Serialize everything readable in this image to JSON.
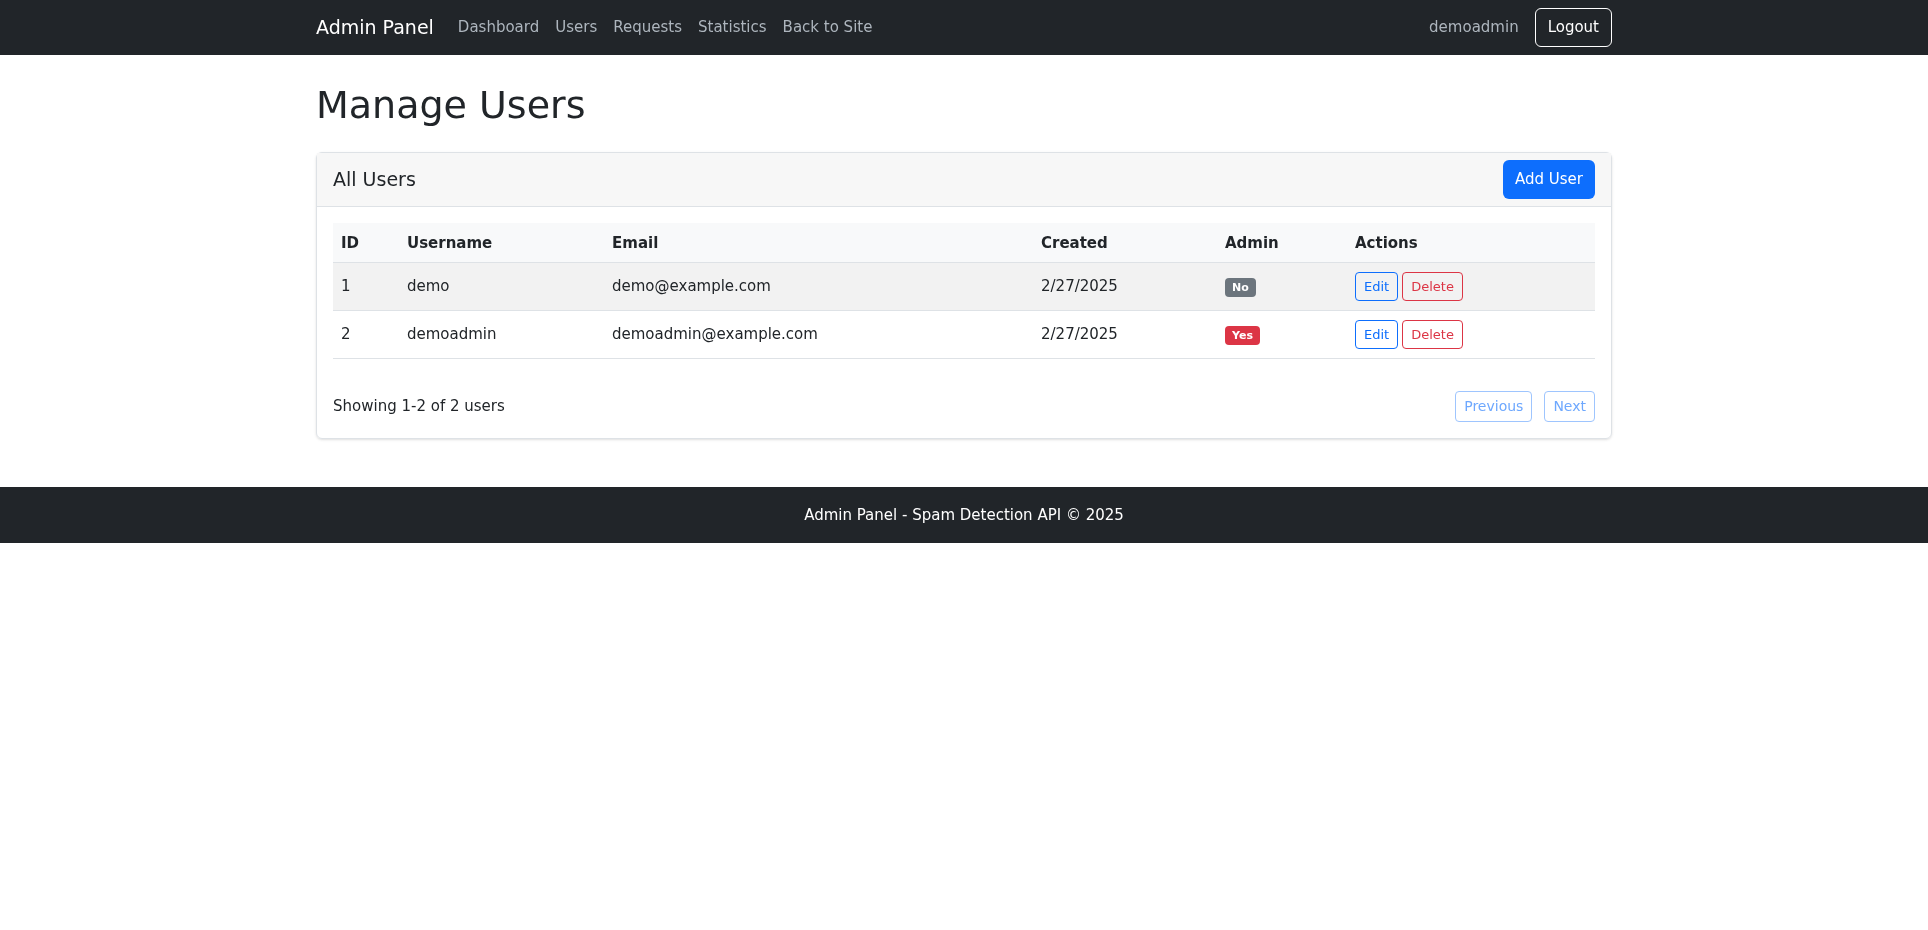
{
  "navbar": {
    "brand": "Admin Panel",
    "links": [
      "Dashboard",
      "Users",
      "Requests",
      "Statistics",
      "Back to Site"
    ],
    "user": "demoadmin",
    "logout": "Logout"
  },
  "page_title": "Manage Users",
  "card": {
    "title": "All Users",
    "add_button": "Add User"
  },
  "table": {
    "columns": [
      "ID",
      "Username",
      "Email",
      "Created",
      "Admin",
      "Actions"
    ],
    "rows": [
      {
        "id": "1",
        "username": "demo",
        "email": "demo@example.com",
        "created": "2/27/2025",
        "admin": false,
        "admin_label": "No",
        "actions": [
          "Edit",
          "Delete"
        ]
      },
      {
        "id": "2",
        "username": "demoadmin",
        "email": "demoadmin@example.com",
        "created": "2/27/2025",
        "admin": true,
        "admin_label": "Yes",
        "actions": [
          "Edit",
          "Delete"
        ]
      }
    ]
  },
  "pagination": {
    "summary": "Showing 1-2 of 2 users",
    "previous": {
      "label": "Previous",
      "disabled": true
    },
    "next": {
      "label": "Next",
      "disabled": true
    }
  },
  "footer": "Admin Panel - Spam Detection API © 2025"
}
